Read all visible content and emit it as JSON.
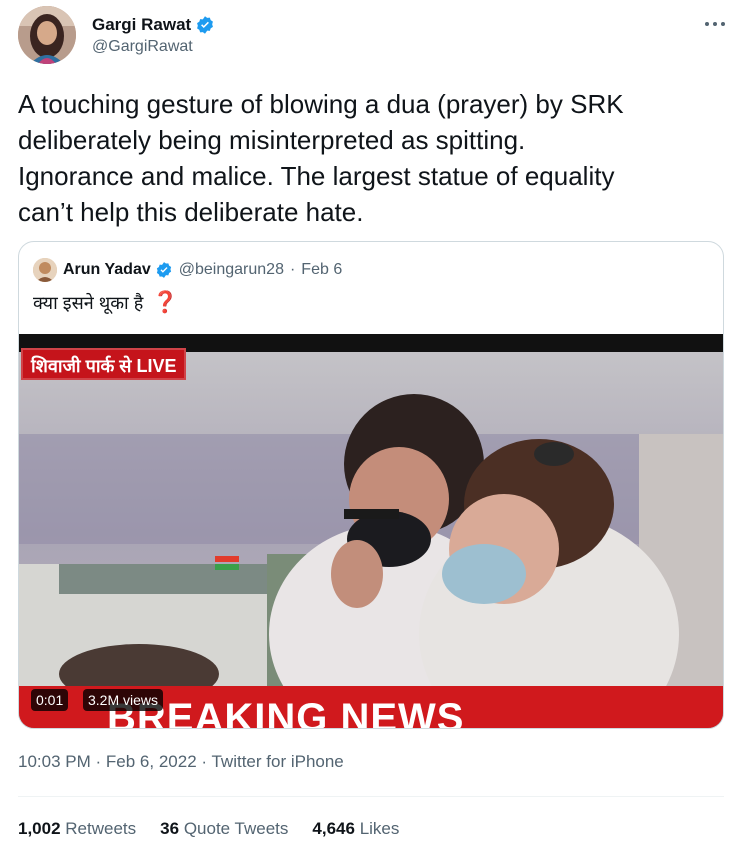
{
  "author": {
    "name": "Gargi Rawat",
    "handle": "@GargiRawat"
  },
  "tweet": {
    "text": "A touching gesture of blowing a dua (prayer) by SRK\ndeliberately being misinterpreted as spitting.\nIgnorance and malice. The largest statue of equality\ncan’t help this deliberate hate."
  },
  "quoted": {
    "name": "Arun Yadav",
    "handle": "@beingarun28",
    "separator": "·",
    "date": "Feb 6",
    "text": "क्या इसने थूका है",
    "question_mark": "❓",
    "video": {
      "live_badge": "शिवाजी पार्क से LIVE",
      "banner_text": "BREAKING NEWS",
      "time": "0:01",
      "views": "3.2M views"
    }
  },
  "meta": {
    "time": "10:03 PM",
    "dot1": "·",
    "date": "Feb 6, 2022",
    "dot2": "·",
    "source": "Twitter for iPhone"
  },
  "stats": {
    "retweets_count": "1,002",
    "retweets_label": "Retweets",
    "quotes_count": "36",
    "quotes_label": "Quote Tweets",
    "likes_count": "4,646",
    "likes_label": "Likes"
  },
  "colors": {
    "verified": "#1d9bf0",
    "secondary_text": "#536471",
    "breaking_red": "#d0191d"
  },
  "icons": [
    "verified-badge-icon",
    "more-options-icon"
  ]
}
